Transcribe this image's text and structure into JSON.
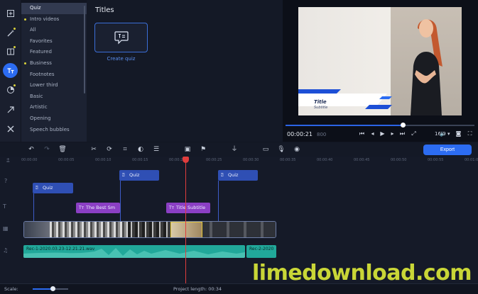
{
  "categories": [
    {
      "label": "Quiz",
      "selected": true,
      "dot": false
    },
    {
      "label": "Intro videos",
      "selected": false,
      "dot": true
    },
    {
      "label": "All",
      "selected": false,
      "dot": false
    },
    {
      "label": "Favorites",
      "selected": false,
      "dot": false
    },
    {
      "label": "Featured",
      "selected": false,
      "dot": false
    },
    {
      "label": "Business",
      "selected": false,
      "dot": true
    },
    {
      "label": "Footnotes",
      "selected": false,
      "dot": false
    },
    {
      "label": "Lower third",
      "selected": false,
      "dot": false
    },
    {
      "label": "Basic",
      "selected": false,
      "dot": false
    },
    {
      "label": "Artistic",
      "selected": false,
      "dot": false
    },
    {
      "label": "Opening",
      "selected": false,
      "dot": false
    },
    {
      "label": "Speech bubbles",
      "selected": false,
      "dot": false
    }
  ],
  "panel": {
    "title": "Titles",
    "card_label": "Create quiz"
  },
  "preview": {
    "lower_third_title": "Title",
    "lower_third_subtitle": "Subtitle",
    "timecode": "00:00:21",
    "timecode_ms": "800",
    "aspect": "16:9 ▾",
    "progress_fraction": 0.62
  },
  "toolbar": {
    "export_label": "Export"
  },
  "ruler": [
    "00:00:00",
    "00:00:05",
    "00:00:10",
    "00:00:15",
    "00:00:20",
    "00:00:25",
    "00:00:30",
    "00:00:35",
    "00:00:40",
    "00:00:45",
    "00:00:50",
    "00:00:55",
    "00:01:00"
  ],
  "clips": {
    "quiz1": "Quiz",
    "quiz2": "Quiz",
    "quiz3": "Quiz",
    "text1": "The Best Sm",
    "text2": "Title Subtitle",
    "audio1": "Rec-1-2020.03.23-12.21.21.wav",
    "audio2": "Rec-2-2020"
  },
  "status": {
    "scale_label": "Scale:",
    "project_length": "Project length:  00:34",
    "scale_fraction": 0.55
  },
  "watermark": "limedownload.com",
  "colors": {
    "accent": "#2c6cf2",
    "quiz": "#2f4fb4",
    "text_clip": "#8b3fc4",
    "audio": "#21a89a",
    "playhead": "#e03d3d",
    "dot": "#d9d23a"
  }
}
